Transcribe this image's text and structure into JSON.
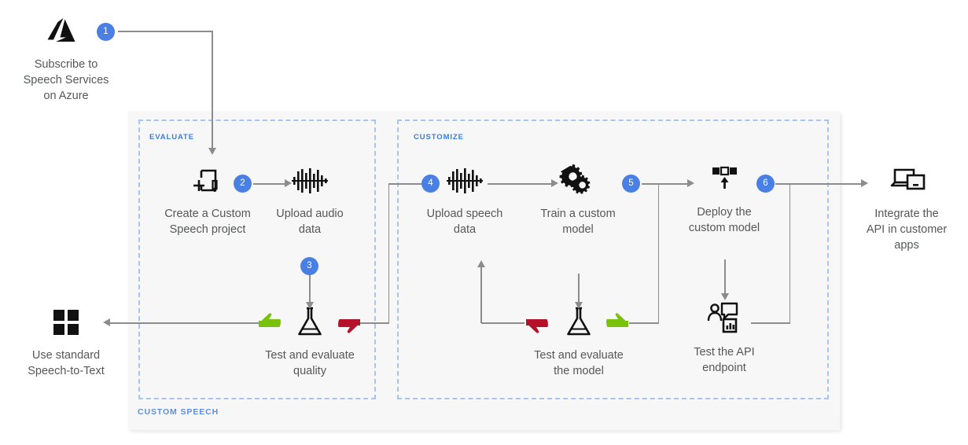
{
  "diagram": {
    "title_hidden": "",
    "outer_container_label": "CUSTOM SPEECH",
    "zones": [
      {
        "id": "evaluate",
        "label": "EVALUATE"
      },
      {
        "id": "customize",
        "label": "CUSTOMIZE"
      }
    ],
    "colors": {
      "badge_blue": "#4a7fe3",
      "zone_border_blue": "#a8c4f0",
      "zone_label_blue": "#3b7de0",
      "outer_label_blue": "#5b8fe6",
      "connector_gray": "#8a8c8e",
      "caption_gray": "#555759",
      "panel_gray": "#f7f7f7",
      "thumbs_up_green": "#7ac10d",
      "thumbs_down_red": "#b4122a",
      "icon_black": "#111111"
    },
    "nodes": [
      {
        "id": "subscribe",
        "icon": "azure-logo-icon",
        "caption": "Subscribe to\nSpeech Services\non Azure"
      },
      {
        "id": "create",
        "icon": "new-document-pen-icon",
        "caption": "Create a Custom\nSpeech project"
      },
      {
        "id": "upload-audio",
        "icon": "audio-waveform-icon",
        "caption": "Upload audio\ndata"
      },
      {
        "id": "test-quality",
        "icon": "flask-icon",
        "caption": "Test and evaluate\nquality"
      },
      {
        "id": "use-standard",
        "icon": "windows-squares-icon",
        "caption": "Use standard\nSpeech-to-Text"
      },
      {
        "id": "upload-speech",
        "icon": "audio-waveform-icon",
        "caption": "Upload speech\ndata"
      },
      {
        "id": "train",
        "icon": "gears-icon",
        "caption": "Train a custom\nmodel"
      },
      {
        "id": "test-model",
        "icon": "flask-icon",
        "caption": "Test and evaluate\nthe model"
      },
      {
        "id": "deploy",
        "icon": "deploy-blocks-arrow-icon",
        "caption": "Deploy the\ncustom model"
      },
      {
        "id": "test-api",
        "icon": "user-chat-endpoint-icon",
        "caption": "Test the API\nendpoint"
      },
      {
        "id": "integrate",
        "icon": "devices-laptop-icon",
        "caption": "Integrate the\nAPI in customer\napps"
      }
    ],
    "badges": [
      {
        "id": "badge-1",
        "label": "1"
      },
      {
        "id": "badge-2",
        "label": "2"
      },
      {
        "id": "badge-3",
        "label": "3"
      },
      {
        "id": "badge-4",
        "label": "4"
      },
      {
        "id": "badge-5",
        "label": "5"
      },
      {
        "id": "badge-6",
        "label": "6"
      }
    ],
    "verdict_markers": [
      {
        "id": "quality-pass",
        "type": "thumbs-up-icon",
        "direction": "left",
        "near": "test-quality"
      },
      {
        "id": "quality-fail",
        "type": "thumbs-down-icon",
        "direction": "right",
        "near": "test-quality"
      },
      {
        "id": "model-fail",
        "type": "thumbs-down-icon",
        "direction": "left",
        "near": "test-model"
      },
      {
        "id": "model-pass",
        "type": "thumbs-up-icon",
        "direction": "right",
        "near": "test-model"
      }
    ]
  }
}
